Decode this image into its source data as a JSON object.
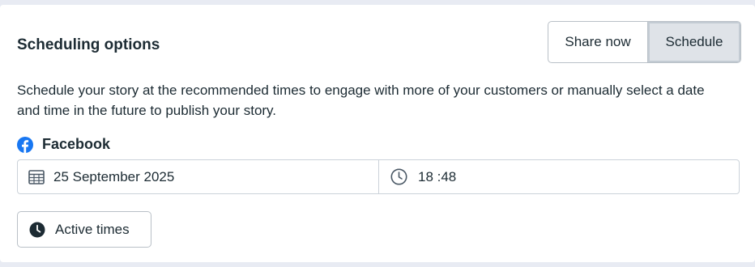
{
  "section": {
    "title": "Scheduling options",
    "description": "Schedule your story at the recommended times to engage with more of your customers or manually select a date and time in the future to publish your story."
  },
  "publish_mode": {
    "options": [
      "Share now",
      "Schedule"
    ],
    "selected": "Schedule"
  },
  "platform": {
    "label": "Facebook",
    "icon": "facebook-icon",
    "brand_color": "#1877f2"
  },
  "schedule": {
    "date": "25 September 2025",
    "time": "18 :48",
    "date_icon": "calendar-icon",
    "time_icon": "clock-icon"
  },
  "active_times": {
    "label": "Active times",
    "icon": "clock-filled-icon"
  }
}
